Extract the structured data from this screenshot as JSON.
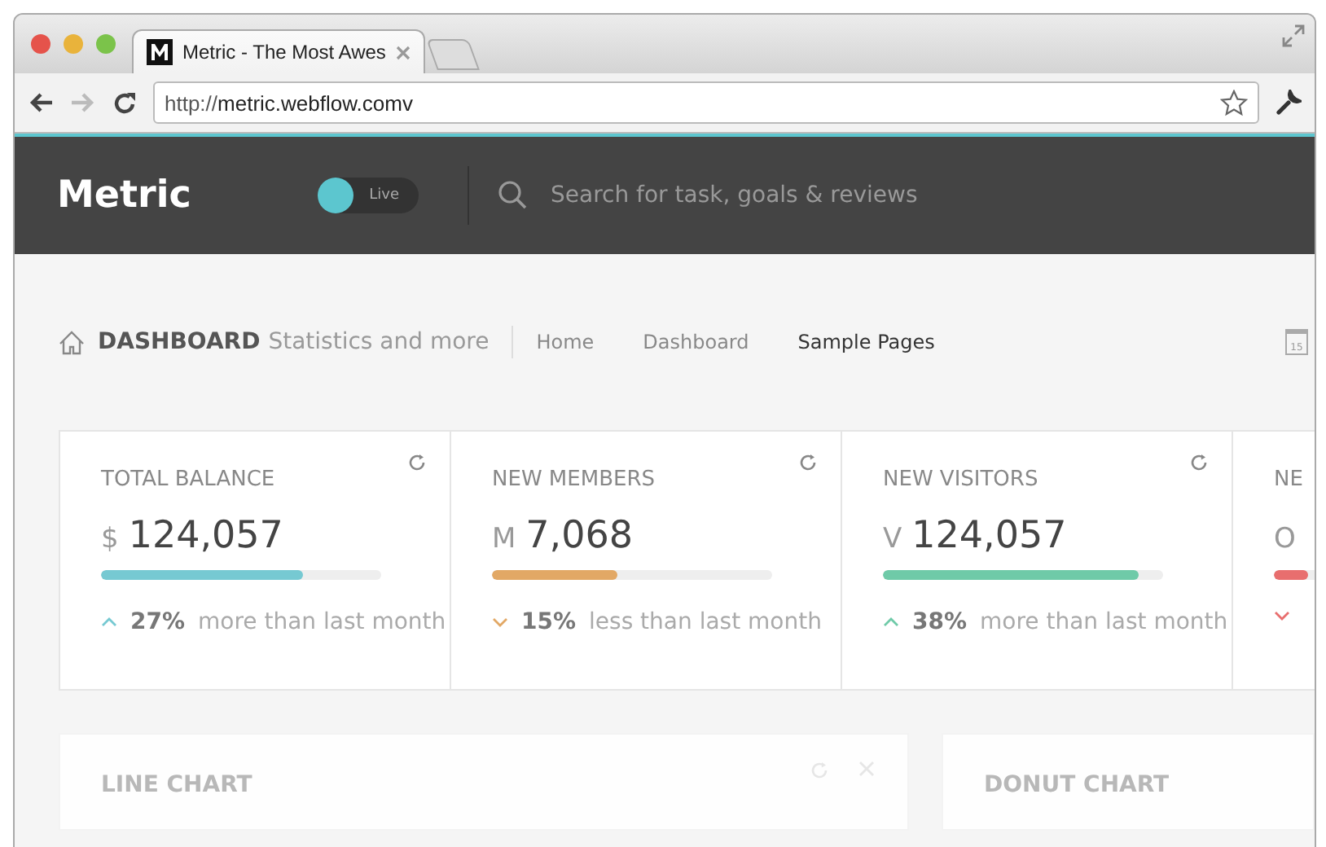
{
  "browser": {
    "tab_title": "Metric - The Most Awes",
    "url_scheme": "http://",
    "url_host": "metric.webflow.comv"
  },
  "header": {
    "logo": "Metric",
    "toggle": {
      "label": "Live",
      "on": true
    },
    "search": {
      "placeholder": "Search for task, goals & reviews"
    }
  },
  "page_header": {
    "title": "DASHBOARD",
    "subtitle": "Statistics and more",
    "calendar_day": "15"
  },
  "nav": [
    {
      "label": "Home",
      "selected": false
    },
    {
      "label": "Dashboard",
      "selected": false
    },
    {
      "label": "Sample Pages",
      "selected": true
    }
  ],
  "stats": [
    {
      "title": "TOTAL BALANCE",
      "prefix": "$",
      "value": "124,057",
      "level": 0.72,
      "color": "#76c9d2",
      "rising": true,
      "percent": "27%",
      "note": "more than last month"
    },
    {
      "title": "NEW MEMBERS",
      "prefix": "M",
      "value": "7,068",
      "level": 0.45,
      "color": "#e2a865",
      "rising": false,
      "percent": "15%",
      "note": "less than last month"
    },
    {
      "title": "NEW VISITORS",
      "prefix": "V",
      "value": "124,057",
      "level": 0.91,
      "color": "#6fcaa8",
      "rising": true,
      "percent": "38%",
      "note": "more than last month"
    },
    {
      "title": "NE",
      "prefix": "O",
      "level": 0.12,
      "color": "#e86e6e",
      "rising": false
    }
  ],
  "panels": [
    {
      "title": "LINE CHART",
      "kind": "wide"
    },
    {
      "title": "DONUT CHART",
      "kind": "narrow"
    }
  ]
}
